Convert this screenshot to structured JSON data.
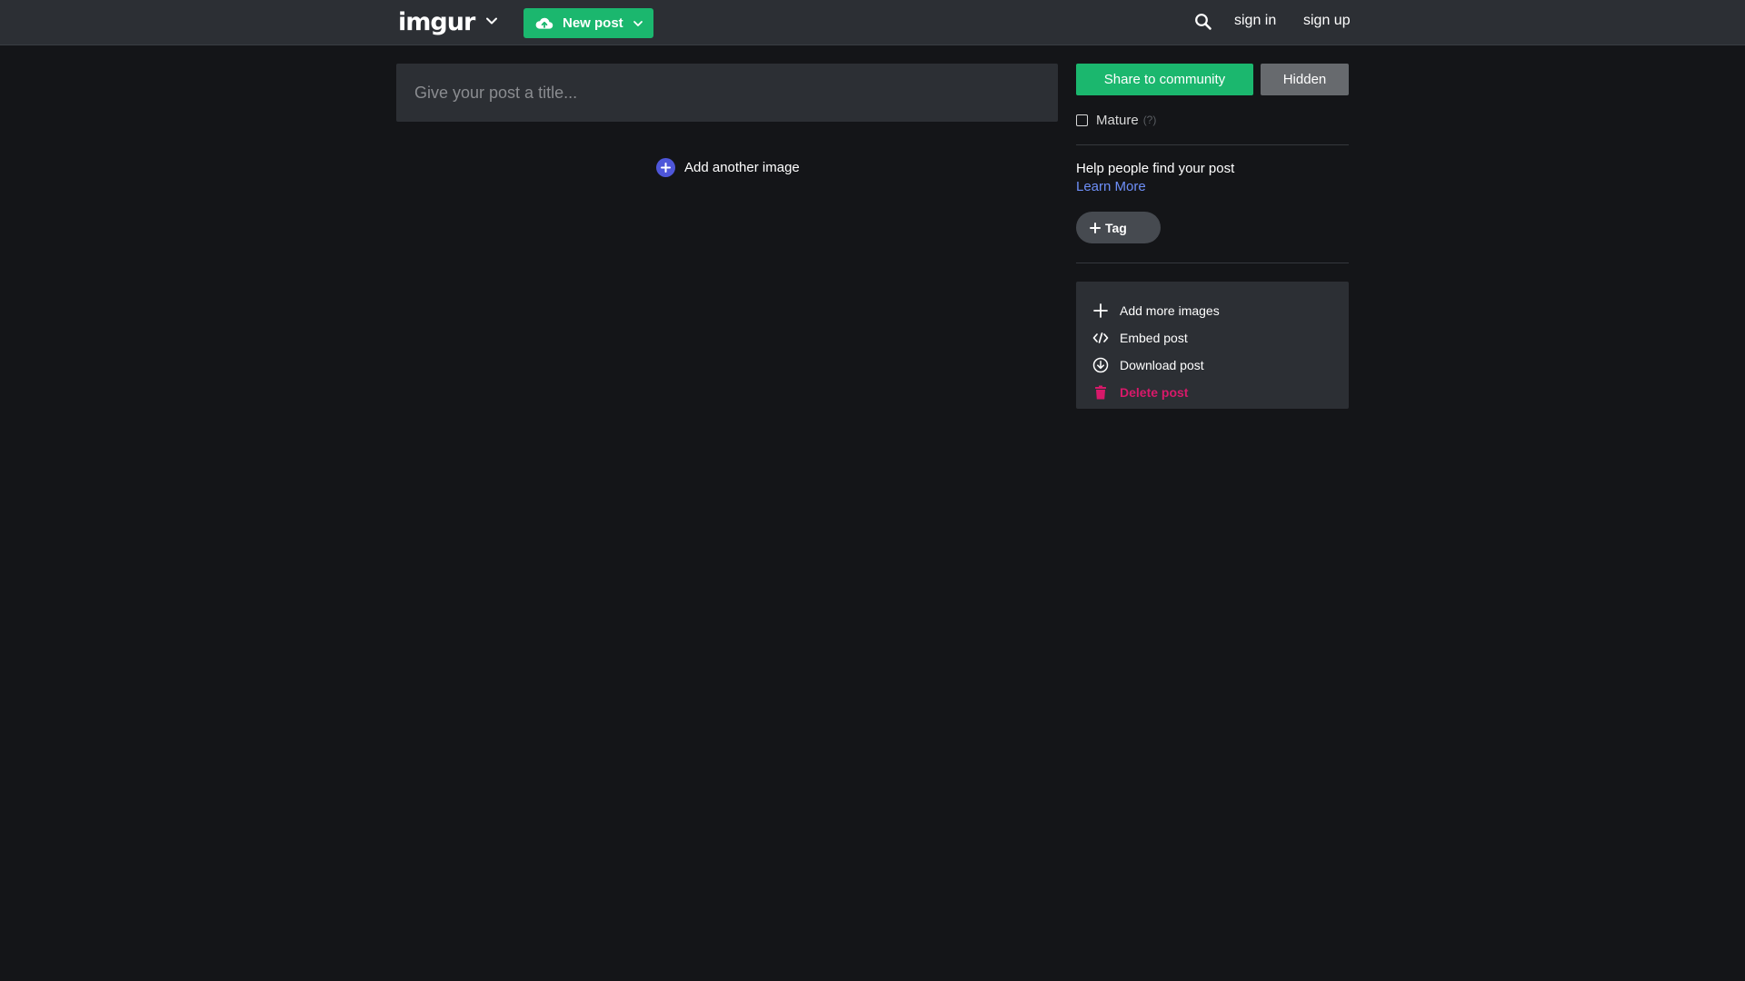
{
  "header": {
    "logo_text": "imgur",
    "new_post_label": "New post",
    "sign_in_label": "sign in",
    "sign_up_label": "sign up"
  },
  "editor": {
    "title_placeholder": "Give your post a title...",
    "title_value": "",
    "add_another_label": "Add another image"
  },
  "sidebar": {
    "share_label": "Share to community",
    "hidden_label": "Hidden",
    "mature_label": "Mature",
    "mature_help": "(?)",
    "help_text": "Help people find your post",
    "learn_more_label": "Learn More",
    "tag_label": "Tag",
    "actions": [
      {
        "label": "Add more images",
        "icon": "plus-icon"
      },
      {
        "label": "Embed post",
        "icon": "code-icon"
      },
      {
        "label": "Download post",
        "icon": "download-icon"
      },
      {
        "label": "Delete post",
        "icon": "trash-icon"
      }
    ]
  },
  "colors": {
    "brand_green": "#1bb76e",
    "accent_blue": "#4e56d9",
    "link_blue": "#6e8ff8",
    "danger_pink": "#d8196a",
    "panel_bg": "#2c2f34",
    "page_bg": "#141518"
  }
}
